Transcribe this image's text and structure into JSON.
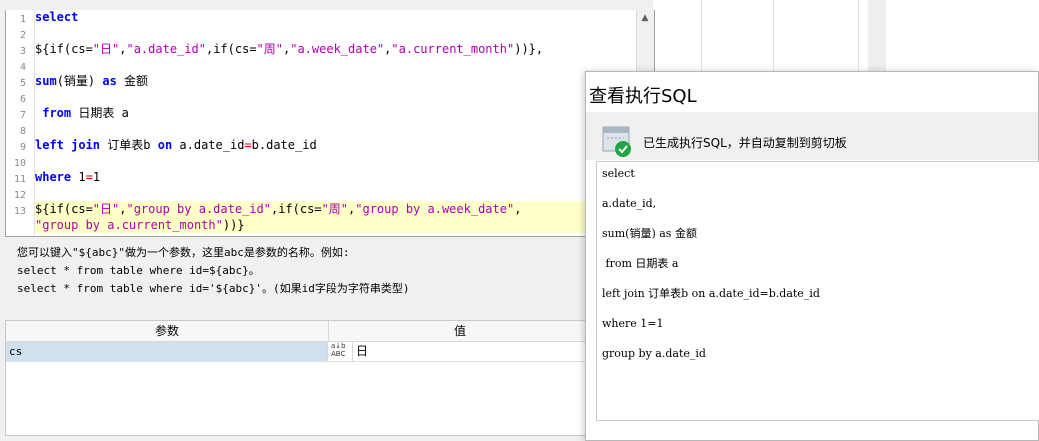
{
  "editor": {
    "line_numbers": [
      "1",
      "2",
      "3",
      "4",
      "5",
      "6",
      "7",
      "8",
      "9",
      "10",
      "11",
      "12",
      "13"
    ],
    "lines": [
      [
        {
          "t": "select",
          "c": "kw"
        }
      ],
      [],
      [
        {
          "t": "${if(cs=",
          "c": ""
        },
        {
          "t": "\"日\"",
          "c": "str"
        },
        {
          "t": ",",
          "c": ""
        },
        {
          "t": "\"a.date_id\"",
          "c": "str"
        },
        {
          "t": ",if(cs=",
          "c": ""
        },
        {
          "t": "\"周\"",
          "c": "str"
        },
        {
          "t": ",",
          "c": ""
        },
        {
          "t": "\"a.week_date\"",
          "c": "str"
        },
        {
          "t": ",",
          "c": ""
        },
        {
          "t": "\"a.current_month\"",
          "c": "str"
        },
        {
          "t": "))},",
          "c": ""
        }
      ],
      [],
      [
        {
          "t": "sum",
          "c": "kw"
        },
        {
          "t": "(销量) ",
          "c": ""
        },
        {
          "t": "as",
          "c": "kw"
        },
        {
          "t": " 金额",
          "c": ""
        }
      ],
      [],
      [
        {
          "t": " ",
          "c": ""
        },
        {
          "t": "from",
          "c": "kw"
        },
        {
          "t": " 日期表 a",
          "c": ""
        }
      ],
      [],
      [
        {
          "t": "left join",
          "c": "kw"
        },
        {
          "t": " 订单表b ",
          "c": ""
        },
        {
          "t": "on",
          "c": "kw"
        },
        {
          "t": " a.date_id",
          "c": ""
        },
        {
          "t": "=",
          "c": "op"
        },
        {
          "t": "b.date_id",
          "c": ""
        }
      ],
      [],
      [
        {
          "t": "where",
          "c": "kw"
        },
        {
          "t": " 1",
          "c": ""
        },
        {
          "t": "=",
          "c": "op"
        },
        {
          "t": "1",
          "c": ""
        }
      ],
      [],
      [
        {
          "t": "${if(cs=",
          "c": ""
        },
        {
          "t": "\"日\"",
          "c": "str"
        },
        {
          "t": ",",
          "c": ""
        },
        {
          "t": "\"group by a.date_id\"",
          "c": "str"
        },
        {
          "t": ",if(cs=",
          "c": ""
        },
        {
          "t": "\"周\"",
          "c": "str"
        },
        {
          "t": ",",
          "c": ""
        },
        {
          "t": "\"group by a.week_date\"",
          "c": "str"
        },
        {
          "t": ",",
          "c": ""
        }
      ],
      [
        {
          "t": "\"group by a.current_month\"",
          "c": "str"
        },
        {
          "t": "))}",
          "c": ""
        }
      ]
    ]
  },
  "help": {
    "line1": "您可以键入\"${abc}\"做为一个参数，这里abc是参数的名称。例如:",
    "line2": "select * from table where id=${abc}。",
    "line3": "select * from table where id='${abc}'。(如果id字段为字符串类型)"
  },
  "grid": {
    "col_param": "参数",
    "col_value": "值",
    "row": {
      "name": "cs",
      "type_icon_text": "ABC",
      "value": "日"
    }
  },
  "dialog": {
    "title": "查看执行SQL",
    "message": "已生成执行SQL，并自动复制到剪切板",
    "icon": "success-check-icon",
    "sql_lines": [
      "select",
      "a.date_id,",
      "sum(销量) as 金额",
      " from 日期表 a",
      "left join 订单表b on a.date_id=b.date_id",
      "where 1=1",
      "group by a.date_id"
    ]
  },
  "colors": {
    "keyword": "#0000ff",
    "string": "#b000b0",
    "highlight_line": "#ffffc8",
    "selected_cell": "#cfe0ee",
    "success_green": "#22a345"
  }
}
